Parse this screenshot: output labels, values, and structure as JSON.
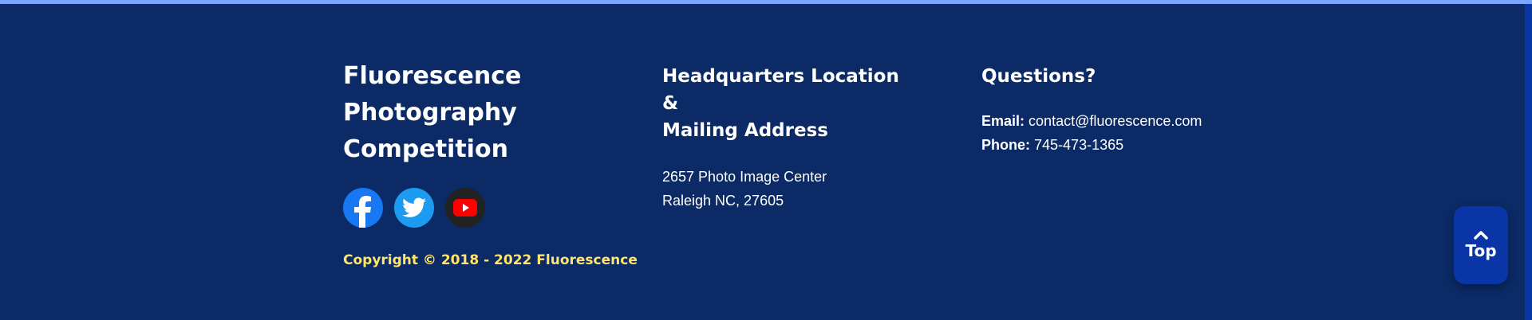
{
  "brand": {
    "line1": "Fluorescence",
    "line2": "Photography",
    "line3": "Competition"
  },
  "headquarters": {
    "heading_line1": "Headquarters Location &",
    "heading_line2": "Mailing Address",
    "address_line1": "2657 Photo Image Center",
    "address_line2": "Raleigh NC, 27605"
  },
  "questions": {
    "heading": "Questions?",
    "email_label": "Email:",
    "email_value": "contact@fluorescence.com",
    "phone_label": "Phone:",
    "phone_value": "745-473-1365"
  },
  "socials": [
    {
      "name": "facebook",
      "icon": "facebook-icon",
      "color": "#1877f2"
    },
    {
      "name": "twitter",
      "icon": "twitter-icon",
      "color": "#1d9bf0"
    },
    {
      "name": "youtube",
      "icon": "youtube-icon",
      "color": "#ff0000"
    }
  ],
  "copyright": "Copyright © 2018 - 2022 Fluorescence",
  "back_to_top": {
    "label": "Top",
    "icon": "chevron-up-icon"
  },
  "colors": {
    "background": "#0b2a66",
    "accent_yellow": "#ffe56a",
    "button": "#0a35a6",
    "top_line": "#7aa6ff"
  }
}
